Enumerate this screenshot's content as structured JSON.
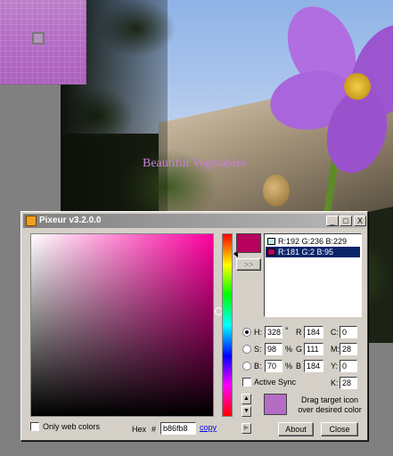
{
  "photo": {
    "caption": "Beautiful Vegetables"
  },
  "window": {
    "title": "Pixeur v3.2.0.0",
    "min_label": "_",
    "max_label": "□",
    "close_label": "X"
  },
  "history": {
    "rows": [
      {
        "text": "R:192 G:236 B:229",
        "color": "#c0ece5"
      },
      {
        "text": "R:181 G:2 B:95",
        "color": "#b5025f"
      }
    ]
  },
  "push_button": ">>",
  "hsb": {
    "h_label": "H:",
    "h_value": "328",
    "h_unit": "°",
    "s_label": "S:",
    "s_value": "98",
    "s_unit": "%",
    "b_label": "B:",
    "b_value": "70",
    "b_unit": "%"
  },
  "rgb": {
    "r_label": "R",
    "r_value": "184",
    "g_label": "G",
    "g_value": "111",
    "b_label": "B",
    "b_value": "184"
  },
  "cmyk": {
    "c_label": "C:",
    "c_value": "0",
    "m_label": "M:",
    "m_value": "28",
    "y_label": "Y:",
    "y_value": "0",
    "k_label": "K:",
    "k_value": "28"
  },
  "active_sync": "Active Sync",
  "drag_hint": "Drag target icon over desired color",
  "only_web_colors": "Only web colors",
  "hex": {
    "label": "Hex",
    "hash": "#",
    "value": "b86fb8",
    "copy_label": "copy"
  },
  "buttons": {
    "about": "About",
    "close": "Close"
  },
  "colors": {
    "current_swatch": "#b8025f",
    "drag_swatch": "#b46cc4"
  }
}
